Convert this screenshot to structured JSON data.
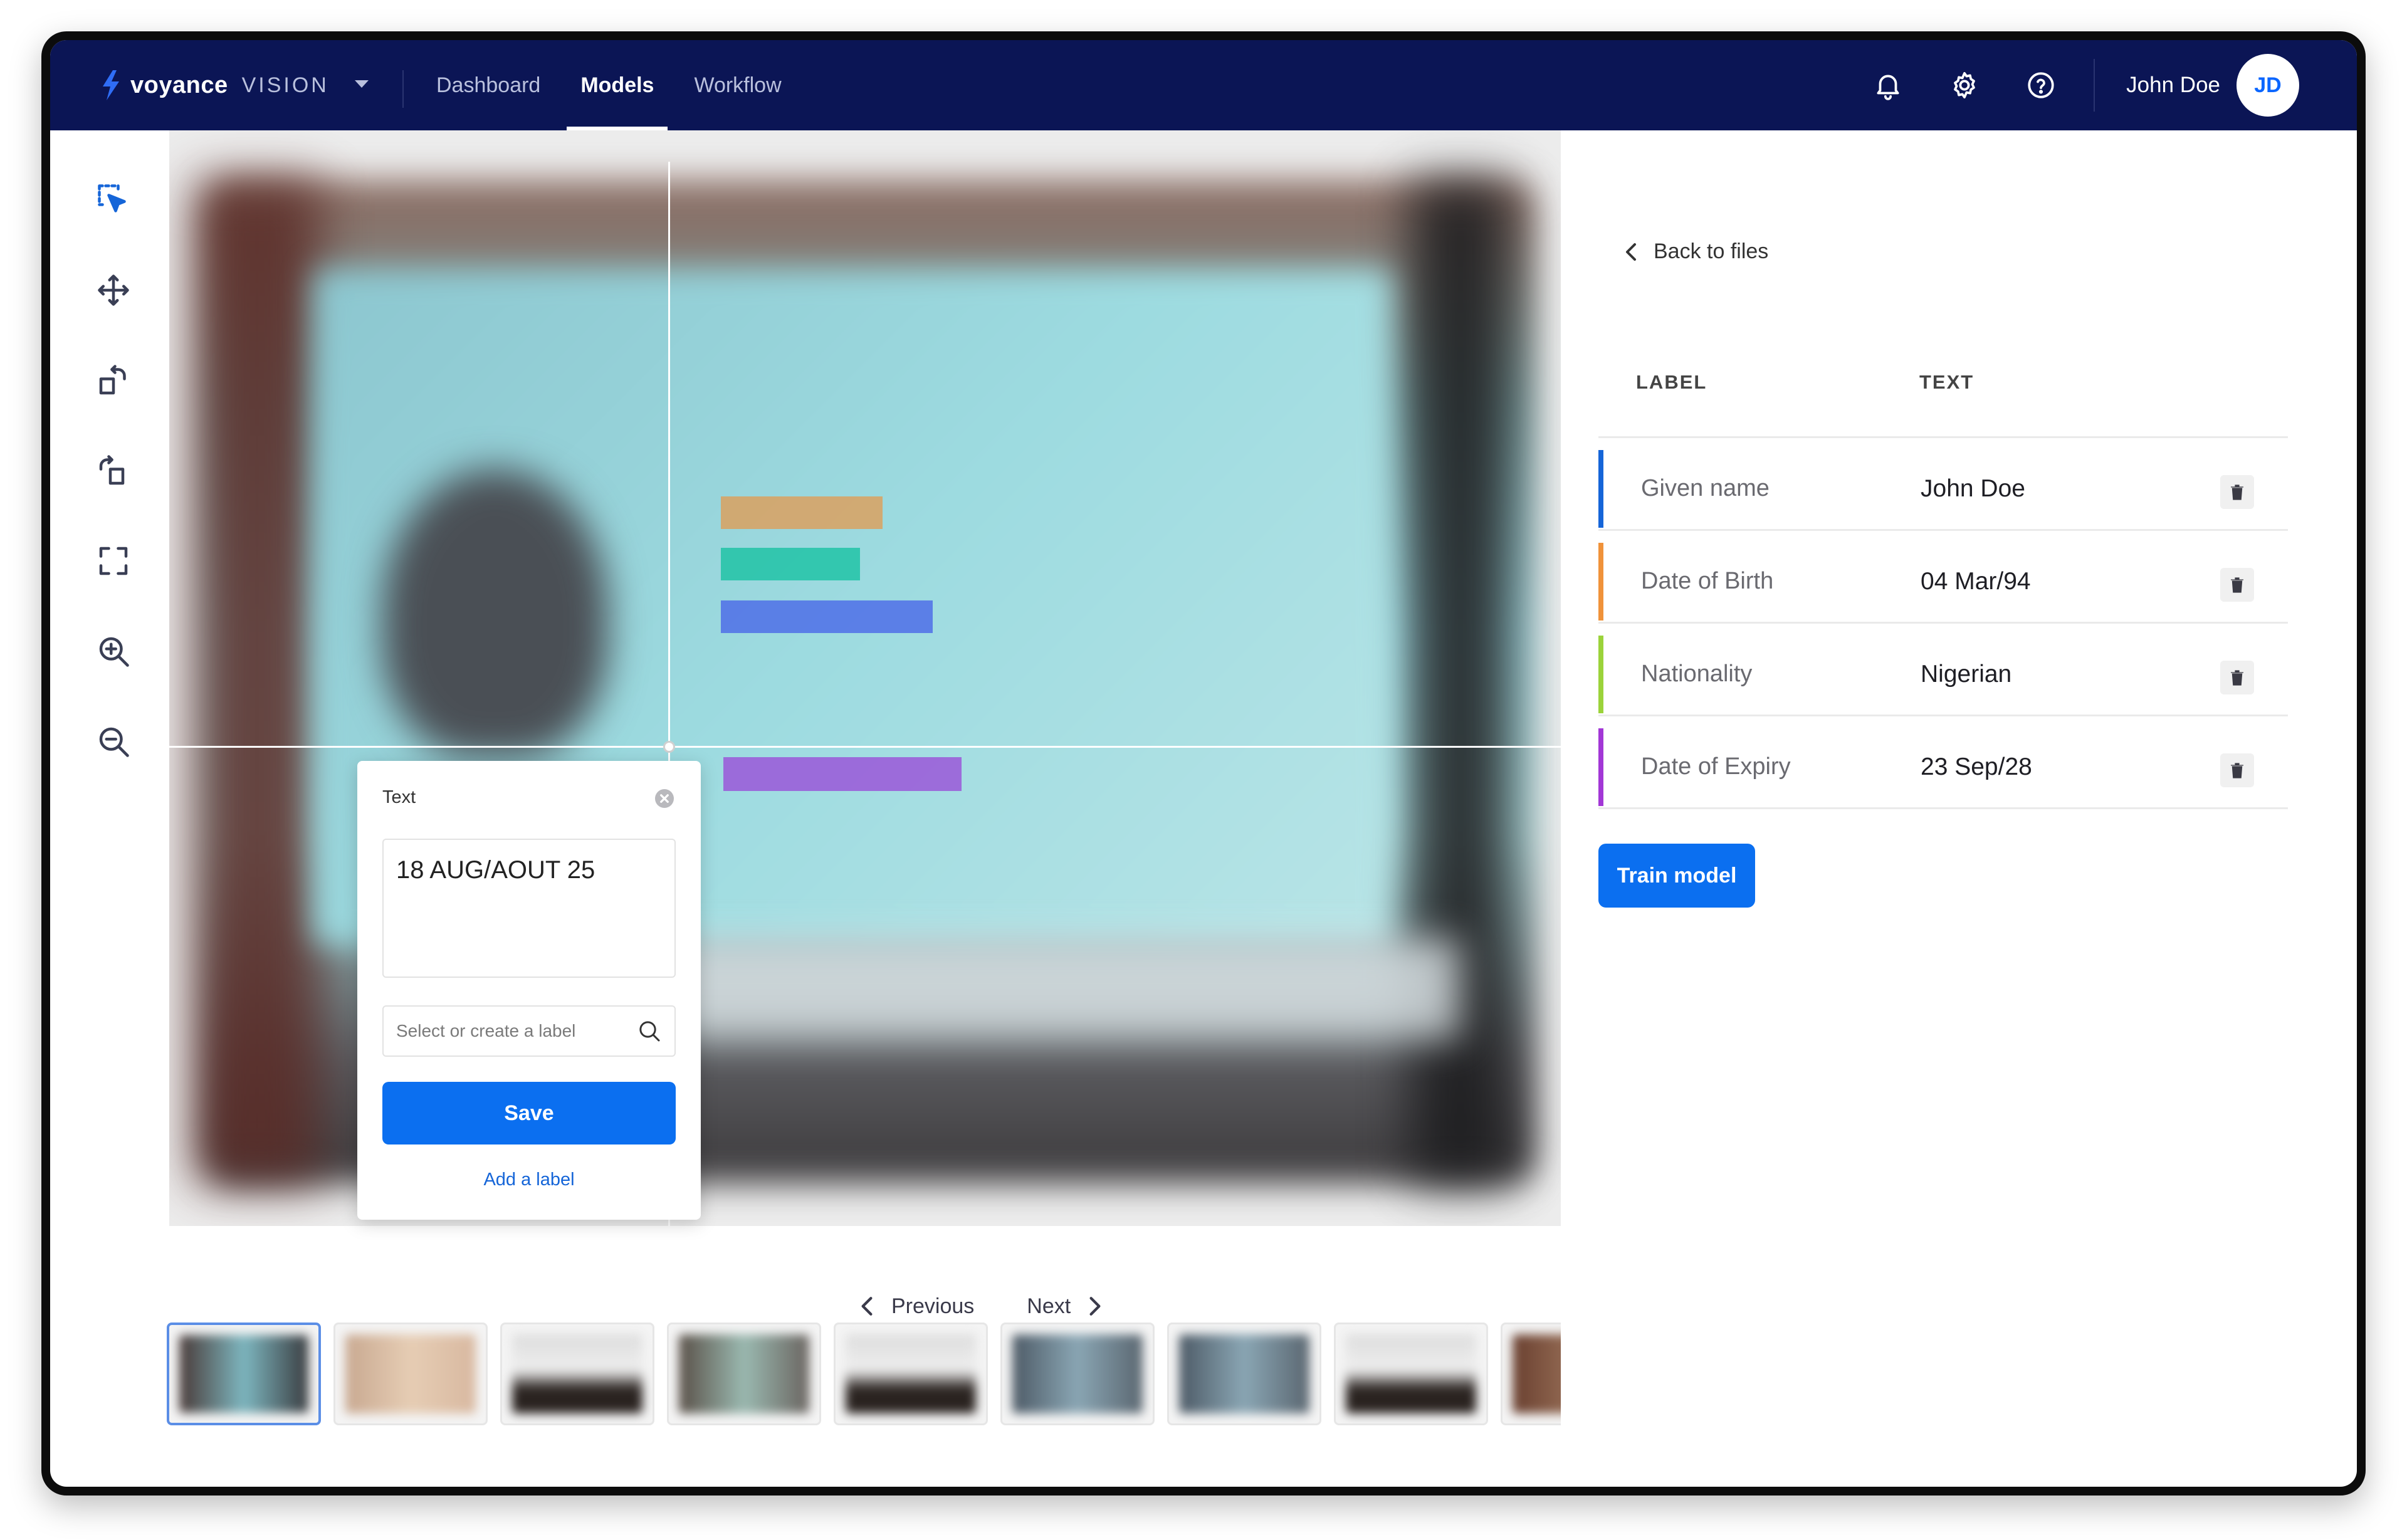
{
  "app": {
    "brand_name": "voyance",
    "brand_sub": "VISION"
  },
  "nav": {
    "items": [
      {
        "label": "Dashboard",
        "active": false
      },
      {
        "label": "Models",
        "active": true
      },
      {
        "label": "Workflow",
        "active": false
      }
    ]
  },
  "topbar": {
    "icons": [
      "bell-icon",
      "gear-icon",
      "help-icon"
    ],
    "user_name": "John Doe",
    "avatar_initials": "JD"
  },
  "toolbar": {
    "tools": [
      "select-region-icon",
      "move-icon",
      "rotate-left-icon",
      "rotate-right-icon",
      "fullscreen-icon",
      "zoom-in-icon",
      "zoom-out-icon"
    ]
  },
  "highlights": [
    {
      "color": "#e39a4f",
      "opacity": 0.75
    },
    {
      "color": "#19c2a2",
      "opacity": 0.8
    },
    {
      "color": "#4f6ee8",
      "opacity": 0.85
    },
    {
      "color": "#9a4fd8",
      "opacity": 0.8
    }
  ],
  "popup": {
    "title": "Text",
    "text_value": "18 AUG/AOUT 25",
    "search_placeholder": "Select or create a label",
    "save_label": "Save",
    "add_label": "Add a label"
  },
  "pager": {
    "previous": "Previous",
    "next": "Next"
  },
  "thumbnails": {
    "selected_index": 0,
    "count_visible": 9
  },
  "panel": {
    "back_label": "Back to files",
    "col_label": "LABEL",
    "col_text": "TEXT",
    "rows": [
      {
        "label": "Given name",
        "text": "John Doe",
        "color": "#1565d8"
      },
      {
        "label": "Date of Birth",
        "text": "04 Mar/94",
        "color": "#f0923a"
      },
      {
        "label": "Nationality",
        "text": "Nigerian",
        "color": "#9bd33a"
      },
      {
        "label": "Date of Expiry",
        "text": "23 Sep/28",
        "color": "#a237d6"
      }
    ],
    "train_label": "Train model"
  },
  "colors": {
    "nav_bg": "#0b1555",
    "accent": "#0b6ff0"
  }
}
